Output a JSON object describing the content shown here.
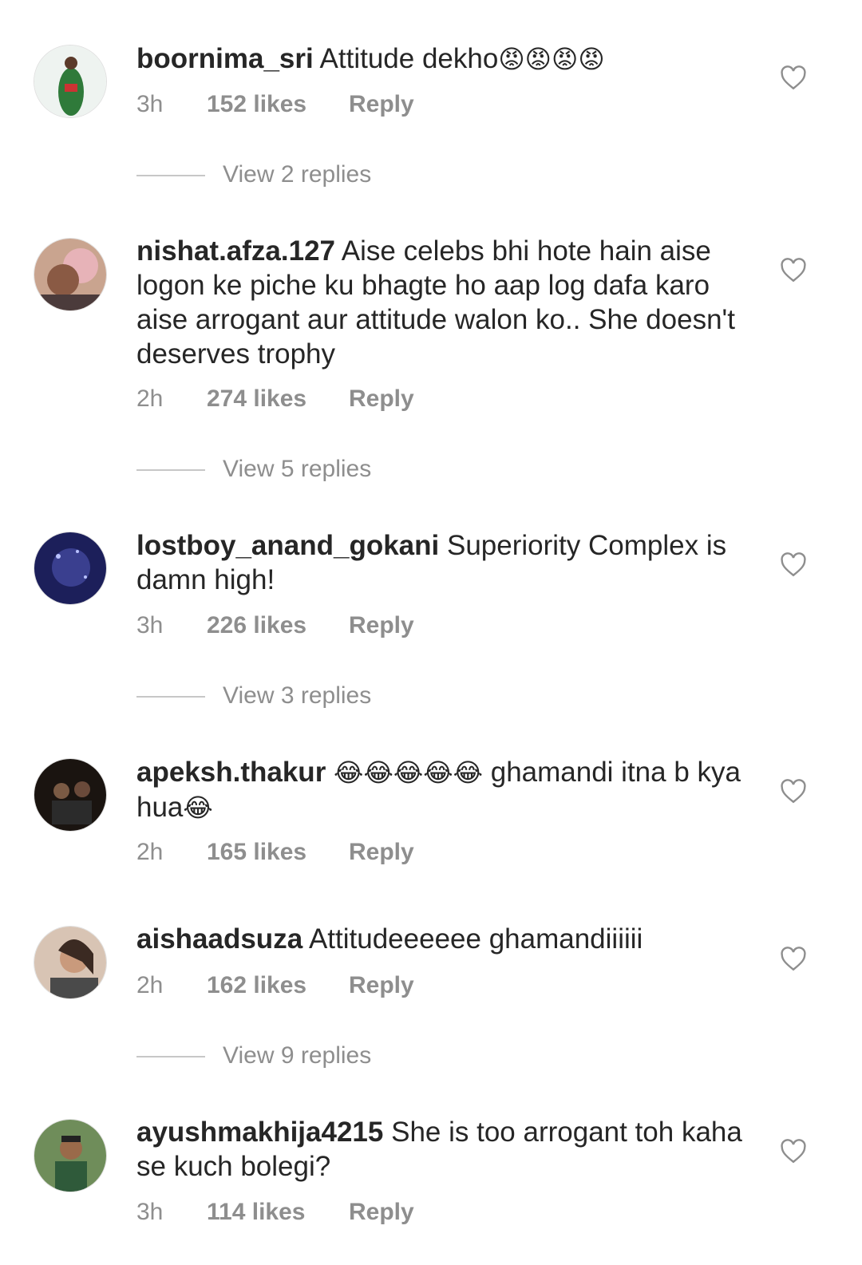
{
  "comments": [
    {
      "username": "boornima_sri",
      "text": "Attitude dekho",
      "emojis": "😡😡😡😡",
      "emojis_after": "",
      "time": "3h",
      "likes": "152 likes",
      "reply": "Reply",
      "view_replies": "View 2 replies"
    },
    {
      "username": "nishat.afza.127",
      "text": "Aise celebs bhi hote hain aise logon ke piche ku bhagte ho aap log dafa karo  aise arrogant aur attitude walon ko.. She doesn't deserves trophy",
      "time": "2h",
      "likes": "274 likes",
      "reply": "Reply",
      "view_replies": "View 5 replies"
    },
    {
      "username": "lostboy_anand_gokani",
      "text": "Superiority Complex  is damn high!",
      "time": "3h",
      "likes": "226 likes",
      "reply": "Reply",
      "view_replies": "View 3 replies"
    },
    {
      "username": "apeksh.thakur",
      "emojis": "😂😂😂😂😂",
      "text": "ghamandi itna b kya hua",
      "emojis_after": "😂",
      "time": "2h",
      "likes": "165 likes",
      "reply": "Reply"
    },
    {
      "username": "aishaadsuza",
      "text": "Attitudeeeeee ghamandiiiiii",
      "time": "2h",
      "likes": "162 likes",
      "reply": "Reply",
      "view_replies": "View 9 replies"
    },
    {
      "username": "ayushmakhija4215",
      "text": "She is too arrogant toh kaha se kuch bolegi?",
      "time": "3h",
      "likes": "114 likes",
      "reply": "Reply"
    }
  ],
  "icons": {
    "like": "heart-outline-icon"
  },
  "colors": {
    "text": "#262626",
    "secondary": "#8e8e8e",
    "divider": "#c7c7c7"
  }
}
